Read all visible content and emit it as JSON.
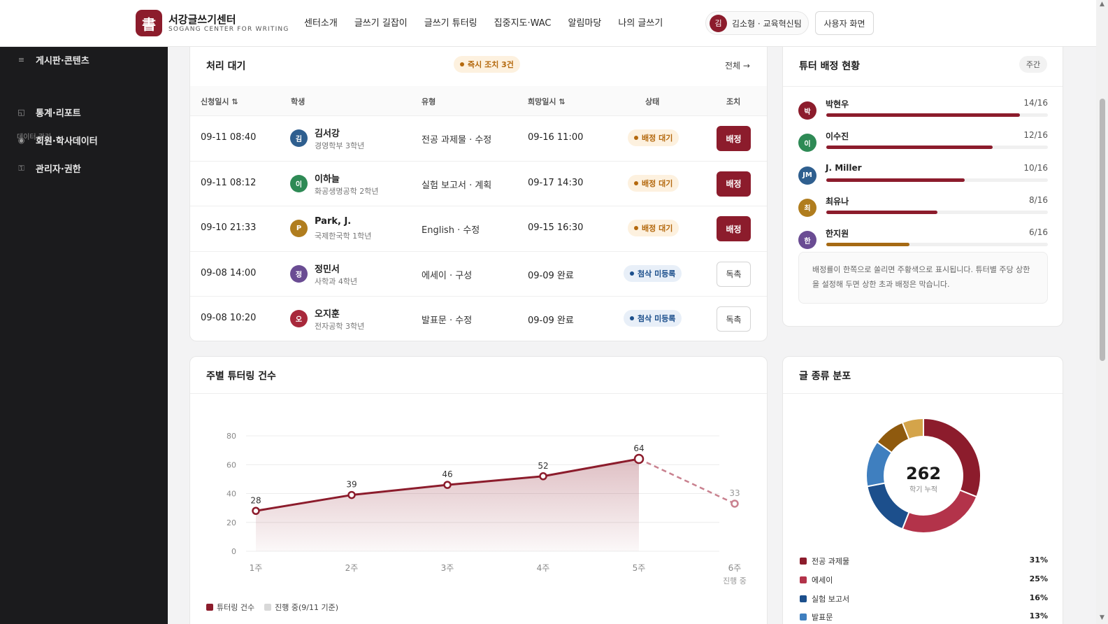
{
  "header": {
    "logo_char": "書",
    "brand_title": "서강글쓰기센터",
    "brand_sub": "SOGANG CENTER FOR WRITING",
    "nav": [
      "센터소개",
      "글쓰기 길잡이",
      "글쓰기 튜터링",
      "집중지도·WAC",
      "알림마당",
      "나의 글쓰기"
    ],
    "user_initial": "김",
    "user_name": "김소형 · 교육혁신팀",
    "user_view_label": "사용자 화면"
  },
  "sidebar": {
    "top_item": "게시판·콘텐츠",
    "group_label": "데이터·관리",
    "items": [
      "통계·리포트",
      "회원·학사데이터",
      "관리자·권한"
    ]
  },
  "queue": {
    "title": "처리 대기",
    "urgent_badge": "즉시 조치 3건",
    "all_link": "전체 →",
    "columns": [
      "신청일시 ⇅",
      "학생",
      "유형",
      "희망일시 ⇅",
      "상태",
      "조치"
    ],
    "rows": [
      {
        "date": "09-11 08:40",
        "initial": "김",
        "avatar_color": "#2f5f8f",
        "name": "김서강",
        "dept": "경영학부 3학년",
        "type": "전공 과제물 · 수정",
        "due": "09-16 11:00",
        "status": "배정 대기",
        "status_kind": "wait",
        "action": "배정",
        "action_kind": "primary"
      },
      {
        "date": "09-11 08:12",
        "initial": "이",
        "avatar_color": "#2e8a55",
        "name": "이하늘",
        "dept": "화공생명공학 2학년",
        "type": "실험 보고서 · 계획",
        "due": "09-17 14:30",
        "status": "배정 대기",
        "status_kind": "wait",
        "action": "배정",
        "action_kind": "primary"
      },
      {
        "date": "09-10 21:33",
        "initial": "P",
        "avatar_color": "#b07d1e",
        "name": "Park, J.",
        "dept": "국제한국학 1학년",
        "type": "English · 수정",
        "due": "09-15 16:30",
        "status": "배정 대기",
        "status_kind": "wait",
        "action": "배정",
        "action_kind": "primary"
      },
      {
        "date": "09-08 14:00",
        "initial": "정",
        "avatar_color": "#6a4c93",
        "name": "정민서",
        "dept": "사학과 4학년",
        "type": "에세이 · 구성",
        "due": "09-09 완료",
        "status": "첨삭 미등록",
        "status_kind": "miss",
        "action": "독촉",
        "action_kind": "ghost"
      },
      {
        "date": "09-08 10:20",
        "initial": "오",
        "avatar_color": "#a8283b",
        "name": "오지훈",
        "dept": "전자공학 3학년",
        "type": "발표문 · 수정",
        "due": "09-09 완료",
        "status": "첨삭 미등록",
        "status_kind": "miss",
        "action": "독촉",
        "action_kind": "ghost"
      }
    ]
  },
  "tutors": {
    "title": "튜터 배정 현황",
    "period_label": "주간",
    "list": [
      {
        "initial": "박",
        "avatar_color": "#8c1c2c",
        "name": "박현우",
        "count": "14/16",
        "ratio": 0.875,
        "bar_color": "#8c1c2c"
      },
      {
        "initial": "이",
        "avatar_color": "#2e8a55",
        "name": "이수진",
        "count": "12/16",
        "ratio": 0.75,
        "bar_color": "#8c1c2c"
      },
      {
        "initial": "JM",
        "avatar_color": "#2f5f8f",
        "name": "J. Miller",
        "count": "10/16",
        "ratio": 0.625,
        "bar_color": "#8c1c2c"
      },
      {
        "initial": "최",
        "avatar_color": "#b07d1e",
        "name": "최유나",
        "count": "8/16",
        "ratio": 0.5,
        "bar_color": "#8c1c2c"
      },
      {
        "initial": "한",
        "avatar_color": "#6a4c93",
        "name": "한지원",
        "count": "6/16",
        "ratio": 0.375,
        "bar_color": "#a66a14"
      }
    ],
    "note": "배정률이 한쪽으로 쏠리면 주황색으로 표시됩니다. 튜터별 주당 상한을 설정해 두면 상한 초과 배정은 막습니다."
  },
  "weekly": {
    "title": "주별 튜터링 건수",
    "legend": [
      "튜터링 건수",
      "진행 중(9/11 기준)"
    ]
  },
  "chart_data": [
    {
      "type": "line",
      "x": [
        "1주",
        "2주",
        "3주",
        "4주",
        "5주",
        "6주"
      ],
      "x_sublabel": "진행 중",
      "series": [
        {
          "name": "튜터링 건수",
          "values": [
            28,
            39,
            46,
            52,
            64,
            null
          ],
          "color": "#8c1c2c"
        },
        {
          "name": "진행 중(9/11 기준)",
          "values": [
            null,
            null,
            null,
            null,
            64,
            33
          ],
          "color": "#c9818f",
          "dashed": true
        }
      ],
      "labels": [
        "28",
        "39",
        "46",
        "52",
        "64",
        "33"
      ],
      "yticks": [
        0,
        20,
        40,
        60,
        80
      ],
      "ylim": [
        0,
        80
      ],
      "grid": true
    },
    {
      "type": "pie",
      "title": "글 종류 분포",
      "center_value": "262",
      "center_label": "학기 누적",
      "slices": [
        {
          "name": "전공 과제물",
          "value": 31,
          "label": "31%",
          "color": "#8c1c2c"
        },
        {
          "name": "에세이",
          "value": 25,
          "label": "25%",
          "color": "#b3334a"
        },
        {
          "name": "실험 보고서",
          "value": 16,
          "label": "16%",
          "color": "#1c4f8c"
        },
        {
          "name": "발표문",
          "value": 13,
          "label": "13%",
          "color": "#3f7fbf"
        },
        {
          "name": "",
          "value": 9,
          "label": "",
          "color": "#8f5a0e"
        },
        {
          "name": "",
          "value": 6,
          "label": "",
          "color": "#d4a44a"
        }
      ]
    }
  ]
}
